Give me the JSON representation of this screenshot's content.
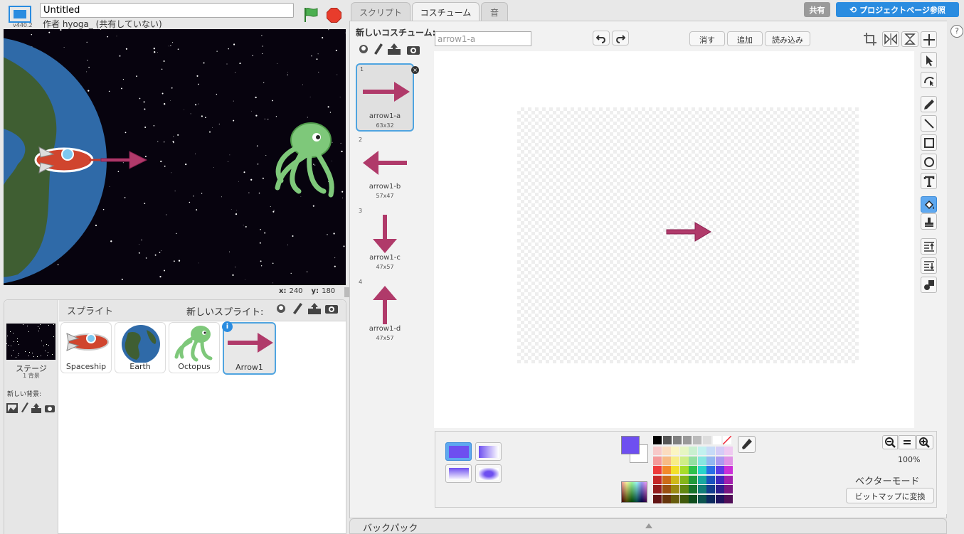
{
  "header": {
    "version": "v440.2",
    "project_title": "Untitled",
    "author": "作者 hyoga_ (共有していない)"
  },
  "stage": {
    "x_label": "x:",
    "x_value": "240",
    "y_label": "y:",
    "y_value": "180"
  },
  "sprites_panel": {
    "title": "スプライト",
    "new_sprite_label": "新しいスプライト:",
    "stage_label": "ステージ",
    "stage_count": "1 背景",
    "new_backdrop_label": "新しい背景:",
    "sprites": [
      {
        "name": "Spaceship"
      },
      {
        "name": "Earth"
      },
      {
        "name": "Octopus"
      },
      {
        "name": "Arrow1"
      }
    ]
  },
  "tabs": [
    {
      "label": "スクリプト"
    },
    {
      "label": "コスチューム"
    },
    {
      "label": "音"
    }
  ],
  "top_right": {
    "share": "共有",
    "project_page": "プロジェクトページ参照",
    "help": "?"
  },
  "costumes": {
    "new_label": "新しいコスチューム:",
    "items": [
      {
        "num": "1",
        "name": "arrow1-a",
        "size": "63x32"
      },
      {
        "num": "2",
        "name": "arrow1-b",
        "size": "57x47"
      },
      {
        "num": "3",
        "name": "arrow1-c",
        "size": "47x57"
      },
      {
        "num": "4",
        "name": "arrow1-d",
        "size": "47x57"
      }
    ]
  },
  "editor": {
    "costume_name": "arrow1-a",
    "clear": "消す",
    "add": "追加",
    "import": "読み込み",
    "zoom": "100%",
    "mode": "ベクターモード",
    "convert_bitmap": "ビットマップに変換",
    "fill_color": "#6e4ff0",
    "accent_color": "#b03a6a"
  },
  "palette": {
    "grays": [
      "#000000",
      "#555555",
      "#7f7f7f",
      "#999999",
      "#bbbbbb",
      "#dddddd",
      "#ffffff"
    ],
    "rows": [
      [
        "#f7c9c9",
        "#fbdcbf",
        "#fbf5c2",
        "#e6f6c2",
        "#c9f0d0",
        "#c2f1ef",
        "#c7dbf7",
        "#d4ccf7",
        "#efc9f1"
      ],
      [
        "#f49a9a",
        "#f7bb85",
        "#f8ed87",
        "#cfee87",
        "#93e0a2",
        "#87e6e0",
        "#93b7f0",
        "#ab9af0",
        "#e093e6"
      ],
      [
        "#ee3b3b",
        "#f28a2a",
        "#f3e02a",
        "#a7dc2a",
        "#2ec24d",
        "#2ad4c9",
        "#2a6fe6",
        "#5a3be6",
        "#cb2ed8"
      ],
      [
        "#c42828",
        "#cc6b18",
        "#cfb81a",
        "#84b51a",
        "#209a3a",
        "#1aa89f",
        "#1a52bd",
        "#3e28bd",
        "#a21eae"
      ],
      [
        "#921d1d",
        "#9a5012",
        "#9b8a13",
        "#628813",
        "#17732b",
        "#137e77",
        "#133d8d",
        "#2d1e8d",
        "#791582"
      ],
      [
        "#611313",
        "#66350c",
        "#675c0d",
        "#415a0d",
        "#0f4d1d",
        "#0d544f",
        "#0d295e",
        "#1e135e",
        "#500e57"
      ]
    ]
  },
  "backpack": {
    "label": "バックパック"
  }
}
